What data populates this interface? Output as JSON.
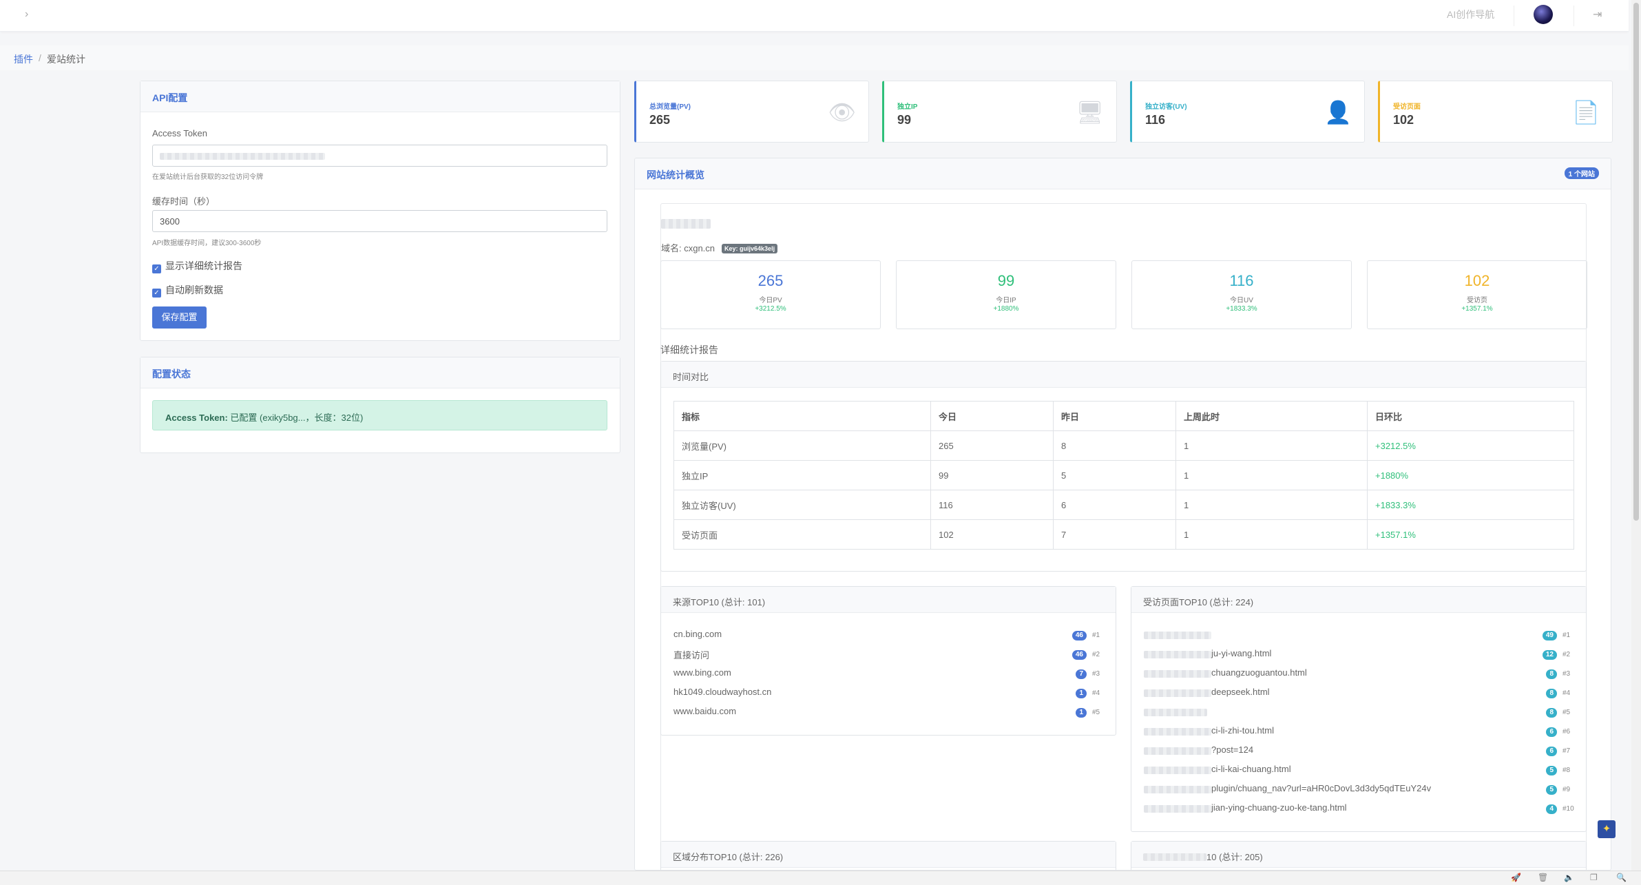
{
  "topbar": {
    "collapse_icon": "chevron-right-icon",
    "nav_link": "AI创作导航",
    "logout_icon": "logout-icon"
  },
  "breadcrumb": {
    "parent": "插件",
    "separator": "/",
    "current": "爱站统计"
  },
  "api_config": {
    "title": "API配置",
    "token_label": "Access Token",
    "token_hint": "在爱站统计后台获取的32位访问令牌",
    "cache_label": "缓存时间（秒）",
    "cache_value": "3600",
    "cache_hint": "API数据缓存时间，建议300-3600秒",
    "show_detail": "显示详细统计报告",
    "auto_refresh": "自动刷新数据",
    "save": "保存配置"
  },
  "config_status": {
    "title": "配置状态",
    "token_strong": "Access Token:",
    "token_text": " 已配置 (exiky5bg...，长度：32位)"
  },
  "stats": [
    {
      "title": "总浏览量(PV)",
      "value": "265",
      "color": "#4a76d6",
      "icon": "eye-icon"
    },
    {
      "title": "独立IP",
      "value": "99",
      "color": "#2fbf7a",
      "icon": "monitor-icon"
    },
    {
      "title": "独立访客(UV)",
      "value": "116",
      "color": "#36b0c9",
      "icon": "user-icon"
    },
    {
      "title": "受访页面",
      "value": "102",
      "color": "#f0b429",
      "icon": "file-icon"
    }
  ],
  "overview": {
    "title": "网站统计概览",
    "badge": "1 个网站",
    "domain_label": "域名: cxgn.cn",
    "key_badge": "Key: guijv64k3elj",
    "metrics": [
      {
        "value": "265",
        "label": "今日PV",
        "change": "+3212.5%",
        "color": "#4a76d6"
      },
      {
        "value": "99",
        "label": "今日IP",
        "change": "+1880%",
        "color": "#2fbf7a"
      },
      {
        "value": "116",
        "label": "今日UV",
        "change": "+1833.3%",
        "color": "#36b0c9"
      },
      {
        "value": "102",
        "label": "受访页",
        "change": "+1357.1%",
        "color": "#f0b429"
      }
    ],
    "detail_title": "详细统计报告",
    "compare_title": "时间对比",
    "table": {
      "headers": [
        "指标",
        "今日",
        "昨日",
        "上周此时",
        "日环比"
      ],
      "rows": [
        [
          "浏览量(PV)",
          "265",
          "8",
          "1",
          "+3212.5%"
        ],
        [
          "独立IP",
          "99",
          "5",
          "1",
          "+1880%"
        ],
        [
          "独立访客(UV)",
          "116",
          "6",
          "1",
          "+1833.3%"
        ],
        [
          "受访页面",
          "102",
          "7",
          "1",
          "+1357.1%"
        ]
      ]
    },
    "sources": {
      "title": "来源TOP10 (总计: 101)",
      "items": [
        {
          "name": "cn.bing.com",
          "count": "46",
          "rank": "#1"
        },
        {
          "name": "直接访问",
          "count": "46",
          "rank": "#2"
        },
        {
          "name": "www.bing.com",
          "count": "7",
          "rank": "#3"
        },
        {
          "name": "hk1049.cloudwayhost.cn",
          "count": "1",
          "rank": "#4"
        },
        {
          "name": "www.baidu.com",
          "count": "1",
          "rank": "#5"
        }
      ]
    },
    "pages": {
      "title": "受访页面TOP10 (总计: 224)",
      "items": [
        {
          "name": "",
          "count": "49",
          "rank": "#1"
        },
        {
          "name": "ju-yi-wang.html",
          "count": "12",
          "rank": "#2"
        },
        {
          "name": "chuangzuoguantou.html",
          "count": "8",
          "rank": "#3"
        },
        {
          "name": "deepseek.html",
          "count": "8",
          "rank": "#4"
        },
        {
          "name": "",
          "count": "8",
          "rank": "#5"
        },
        {
          "name": "ci-li-zhi-tou.html",
          "count": "6",
          "rank": "#6"
        },
        {
          "name": "?post=124",
          "count": "6",
          "rank": "#7"
        },
        {
          "name": "ci-li-kai-chuang.html",
          "count": "5",
          "rank": "#8"
        },
        {
          "name": "plugin/chuang_nav?url=aHR0cDovL3d3dy5qdTEuY24v",
          "count": "5",
          "rank": "#9"
        },
        {
          "name": "jian-ying-chuang-zuo-ke-tang.html",
          "count": "4",
          "rank": "#10"
        }
      ]
    },
    "region_title": "区域分布TOP10 (总计: 226)",
    "other_title": "10 (总计: 205)"
  }
}
